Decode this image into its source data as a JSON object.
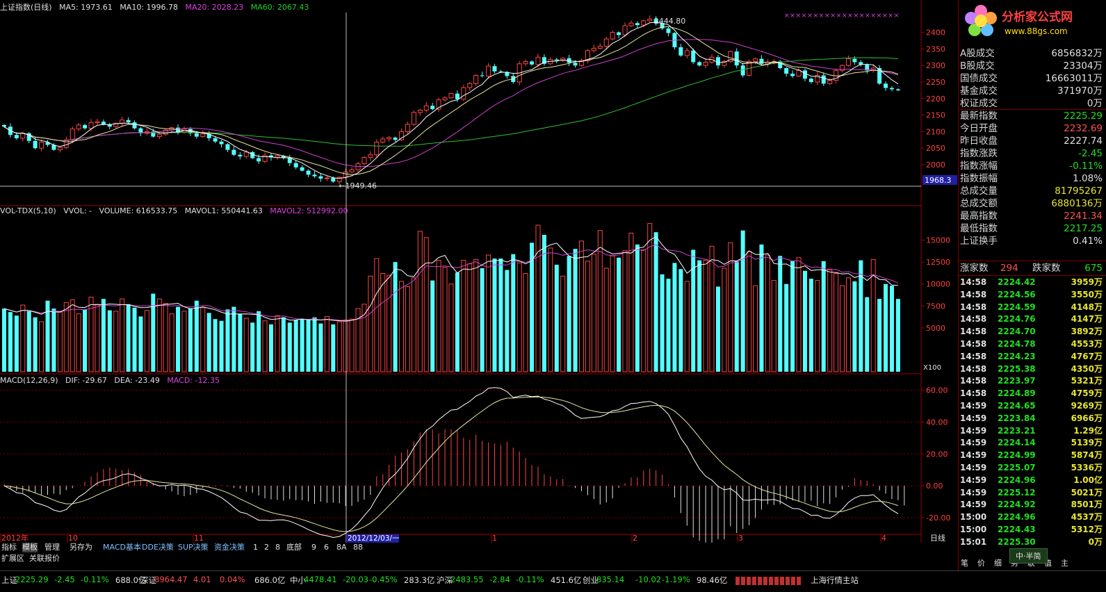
{
  "header": {
    "kline": {
      "name": "上证指数(日线)",
      "ma5": "MA5: 1973.61",
      "ma10": "MA10: 1996.78",
      "ma20": "MA20: 2028.23",
      "ma60": "MA60: 2067.43"
    },
    "vol": {
      "name": "VOL-TDX(5,10)",
      "vvol": "VVOL: -",
      "volume": "VOLUME: 616533.75",
      "mavol1": "MAVOL1: 550441.63",
      "mavol2": "MAVOL2: 512992.00"
    },
    "macd": {
      "name": "MACD(12,26,9)",
      "dif": "DIF: -29.67",
      "dea": "DEA: -23.49",
      "macd": "MACD: -12.35"
    }
  },
  "annotations": {
    "high": "2444.80",
    "low": "←1949.46",
    "low_value": 1949.46,
    "hline_label": "1968.3",
    "x100": "X100",
    "cursor_date": "2012/12/03/一"
  },
  "x_axis_labels": [
    "2012年",
    "10",
    "11",
    "1",
    "2",
    "3",
    "4"
  ],
  "period_label": "日线",
  "chart_data": [
    {
      "type": "candlestick",
      "title": "上证指数(日线)",
      "ylim": [
        1935,
        2460
      ],
      "y_ticks": [
        2000,
        2050,
        2100,
        2150,
        2200,
        2250,
        2300,
        2350,
        2400
      ],
      "high_marker": 2444.8,
      "low_marker": 1949.46,
      "close": [
        2115,
        2090,
        2080,
        2095,
        2072,
        2050,
        2068,
        2060,
        2045,
        2052,
        2075,
        2108,
        2120,
        2110,
        2127,
        2130,
        2122,
        2115,
        2125,
        2135,
        2128,
        2110,
        2095,
        2100,
        2085,
        2092,
        2105,
        2112,
        2098,
        2108,
        2095,
        2085,
        2093,
        2080,
        2070,
        2062,
        2045,
        2030,
        2025,
        2038,
        2020,
        2010,
        2028,
        2022,
        2027,
        2020,
        2005,
        1992,
        1982,
        1970,
        1965,
        1958,
        1960,
        1949,
        1962,
        1978,
        1985,
        2003,
        2022,
        2030,
        2068,
        2078,
        2082,
        2075,
        2100,
        2122,
        2158,
        2165,
        2178,
        2168,
        2196,
        2202,
        2215,
        2198,
        2233,
        2245,
        2270,
        2268,
        2298,
        2282,
        2280,
        2268,
        2250,
        2305,
        2312,
        2303,
        2325,
        2305,
        2318,
        2315,
        2322,
        2308,
        2300,
        2315,
        2345,
        2352,
        2358,
        2380,
        2400,
        2392,
        2420,
        2428,
        2422,
        2435,
        2440,
        2428,
        2412,
        2398,
        2355,
        2330,
        2345,
        2310,
        2300,
        2310,
        2325,
        2300,
        2312,
        2342,
        2300,
        2270,
        2312,
        2320,
        2305,
        2310,
        2312,
        2292,
        2275,
        2268,
        2285,
        2260,
        2250,
        2270,
        2245,
        2255,
        2285,
        2300,
        2320,
        2310,
        2302,
        2285,
        2292,
        2245,
        2232,
        2228,
        2225
      ]
    },
    {
      "type": "bar",
      "title": "VOL-TDX(5,10)",
      "ylim": [
        0,
        17500
      ],
      "y_ticks": [
        5000,
        7500,
        10000,
        12500,
        15000
      ],
      "series": [
        {
          "name": "VOLUME",
          "values": [
            7200,
            6800,
            6400,
            7600,
            6900,
            6200,
            5700,
            8100,
            7200,
            6800,
            7900,
            8200,
            6600,
            7100,
            8500,
            7700,
            8300,
            7000,
            6900,
            8300,
            7700,
            7300,
            6300,
            7000,
            8900,
            8300,
            7800,
            6600,
            7400,
            6900,
            7200,
            8100,
            7300,
            6700,
            6000,
            5800,
            7100,
            7400,
            6600,
            6100,
            5600,
            6900,
            5800,
            5400,
            6400,
            6200,
            5600,
            5900,
            6000,
            5900,
            6200,
            5500,
            6300,
            5400,
            5700,
            5900,
            6000,
            7200,
            7700,
            10900,
            12900,
            11200,
            11000,
            12500,
            10300,
            9700,
            10700,
            16000,
            15300,
            10400,
            12700,
            11900,
            10000,
            11300,
            12700,
            12300,
            12800,
            11800,
            13300,
            12900,
            12900,
            11600,
            13400,
            12400,
            11200,
            14700,
            16700,
            15600,
            14100,
            12200,
            10900,
            13200,
            14000,
            14900,
            12600,
            13400,
            16100,
            11800,
            13200,
            13000,
            13800,
            15800,
            14500,
            13900,
            16900,
            15900,
            11100,
            10600,
            12400,
            11700,
            10300,
            13900,
            12700,
            12700,
            14300,
            9700,
            11800,
            14700,
            12600,
            16100,
            13700,
            9800,
            14500,
            13300,
            10400,
            13200,
            10000,
            12600,
            13000,
            11500,
            10600,
            10400,
            12600,
            11700,
            11200,
            9800,
            10700,
            10300,
            12700,
            8500,
            12800,
            8300,
            10000,
            9800,
            8300
          ]
        }
      ]
    },
    {
      "type": "bar",
      "title": "MACD(12,26,9)",
      "ylim": [
        -30,
        65
      ],
      "y_ticks": [
        -20,
        0,
        20,
        40,
        60
      ],
      "series": [
        {
          "name": "MACD",
          "values": [
            1.2,
            -1.7,
            -3.1,
            -4.2,
            -3.6,
            -4.5,
            -5.7,
            -5.7,
            -5.0,
            -5.5,
            -2.7,
            -1.4,
            0.0,
            2.4,
            5.9,
            8.4,
            10.5,
            11.4,
            10.7,
            9.9,
            10.5,
            8.5,
            6.7,
            4.1,
            1.8,
            -0.4,
            -2.3,
            -3.5,
            -5.6,
            -6.5,
            -5.8,
            -4.6,
            -1.4,
            -0.3,
            -0.3,
            0.3,
            -0.3,
            -1.3,
            -1.8,
            -3.8,
            -4.4,
            -6.0,
            -7.9,
            -8.5,
            -8.8,
            -9.3,
            -8.4,
            -9.0,
            -9.1,
            -9.8,
            -11.3,
            -9.9,
            -10.6,
            -10.6,
            -11.0,
            -12.7,
            -12.6,
            -10.1,
            -8.7,
            -5.7,
            6.0,
            7.3,
            13.1,
            19.0,
            20.8,
            23.0,
            27.9,
            33.4,
            35.6,
            35.3,
            32.9,
            35.6,
            35.5,
            34.9,
            30.1,
            29.1,
            32.1,
            28.2,
            27.2,
            26.5,
            25.7,
            27.7,
            24.0,
            21.5,
            17.5,
            13.0,
            12.1,
            7.3,
            5.8,
            4.1,
            4.4,
            -0.2,
            -1.4,
            -3.3,
            -5.9,
            -8.3,
            -11.7,
            -10.5,
            -7.9,
            -1.2,
            1.6,
            5.2,
            5.3,
            9.4,
            10.6,
            9.8,
            7.1,
            1.0,
            -7.3,
            -17.1,
            -25.0,
            -32.3,
            -34.5,
            -35.6,
            -35.8,
            -33.6,
            -33.6,
            -25.4,
            -29.6,
            -27.1,
            -24.7,
            -20.2,
            -14.9,
            -11.6,
            -12.0,
            -11.6,
            -8.6,
            -9.2,
            -10.1,
            -10.2,
            -9.3,
            -12.7,
            -11.0,
            -11.4,
            -7.2,
            -2.4,
            -0.5,
            4.8,
            3.6,
            3.1,
            1.1,
            -2.9,
            -4.9,
            -8.3,
            -9.0,
            -12.3
          ]
        }
      ]
    }
  ],
  "right_panel": {
    "logo_title": "分析家公式网",
    "logo_url": "www.88gs.com",
    "quotes": [
      {
        "label": "A股成交",
        "value": "6856832万",
        "color": "#e0e0e0"
      },
      {
        "label": "B股成交",
        "value": "23304万",
        "color": "#e0e0e0"
      },
      {
        "label": "国债成交",
        "value": "16663011万",
        "color": "#e0e0e0"
      },
      {
        "label": "基金成交",
        "value": "371970万",
        "color": "#e0e0e0"
      },
      {
        "label": "权证成交",
        "value": "0万",
        "color": "#e0e0e0"
      },
      {
        "label": "最新指数",
        "value": "2225.29",
        "color": "#20e020"
      },
      {
        "label": "今日开盘",
        "value": "2232.69",
        "color": "#ff5050"
      },
      {
        "label": "昨日收盘",
        "value": "2227.74",
        "color": "#e0e0e0"
      },
      {
        "label": "指数涨跌",
        "value": "-2.45",
        "color": "#20e020"
      },
      {
        "label": "指数涨幅",
        "value": "-0.11%",
        "color": "#20e020"
      },
      {
        "label": "指数振幅",
        "value": "1.08%",
        "color": "#e0e0e0"
      },
      {
        "label": "总成交量",
        "value": "81795267",
        "color": "#e8e830"
      },
      {
        "label": "总成交额",
        "value": "6880136万",
        "color": "#e8e830"
      },
      {
        "label": "最高指数",
        "value": "2241.34",
        "color": "#ff5050"
      },
      {
        "label": "最低指数",
        "value": "2217.25",
        "color": "#20e020"
      },
      {
        "label": "上证换手",
        "value": "0.41%",
        "color": "#e0e0e0"
      }
    ],
    "advdec": {
      "up_label": "涨家数",
      "up": "294",
      "down_label": "跌家数",
      "down": "675"
    },
    "ticks": [
      {
        "t": "14:58",
        "p": "2224.42",
        "v": "3959万"
      },
      {
        "t": "14:58",
        "p": "2224.56",
        "v": "3550万"
      },
      {
        "t": "14:58",
        "p": "2224.59",
        "v": "4148万"
      },
      {
        "t": "14:58",
        "p": "2224.76",
        "v": "4147万"
      },
      {
        "t": "14:58",
        "p": "2224.70",
        "v": "3892万"
      },
      {
        "t": "14:58",
        "p": "2224.78",
        "v": "4553万"
      },
      {
        "t": "14:58",
        "p": "2224.23",
        "v": "4767万"
      },
      {
        "t": "14:58",
        "p": "2225.38",
        "v": "4350万"
      },
      {
        "t": "14:58",
        "p": "2223.97",
        "v": "5321万"
      },
      {
        "t": "14:58",
        "p": "2224.89",
        "v": "4759万"
      },
      {
        "t": "14:59",
        "p": "2224.65",
        "v": "9269万"
      },
      {
        "t": "14:59",
        "p": "2223.84",
        "v": "6966万"
      },
      {
        "t": "14:59",
        "p": "2223.21",
        "v": "1.29亿"
      },
      {
        "t": "14:59",
        "p": "2224.14",
        "v": "5139万"
      },
      {
        "t": "14:59",
        "p": "2224.99",
        "v": "5874万"
      },
      {
        "t": "14:59",
        "p": "2225.07",
        "v": "5336万"
      },
      {
        "t": "14:59",
        "p": "2224.96",
        "v": "1.00亿"
      },
      {
        "t": "14:59",
        "p": "2225.12",
        "v": "5021万"
      },
      {
        "t": "14:59",
        "p": "2224.92",
        "v": "8501万"
      },
      {
        "t": "15:00",
        "p": "2224.96",
        "v": "4537万"
      },
      {
        "t": "15:00",
        "p": "2224.43",
        "v": "5312万"
      },
      {
        "t": "15:01",
        "p": "2225.30",
        "v": "0万"
      }
    ],
    "buttons": [
      "笔",
      "价",
      "细",
      "势",
      "联",
      "值",
      "主"
    ],
    "badge": "中·半简"
  },
  "tabs": [
    "指标",
    "模板",
    "管理",
    "另存为",
    "MACD基本",
    "DDE决策",
    "SUP决策",
    "资金决策",
    "1",
    "2",
    "8",
    "底部",
    "9",
    "6",
    "8A",
    "88"
  ],
  "tabs2": [
    "扩展区",
    "关联报价"
  ],
  "status": [
    {
      "name": "上证",
      "price": "2225.29",
      "chg": "-2.45",
      "pct": "-0.11%",
      "amt": "688.0亿"
    },
    {
      "name": "深证",
      "price": "8964.47",
      "chg": "4.01",
      "pct": "0.04%",
      "amt": "686.0亿"
    },
    {
      "name": "中小",
      "price": "4478.41",
      "chg": "-20.03",
      "pct": "-0.45%",
      "amt": "283.3亿"
    },
    {
      "name": "沪深",
      "price": "2483.55",
      "chg": "-2.84",
      "pct": "-0.11%",
      "amt": "451.6亿"
    },
    {
      "name": "创业",
      "price": "835.14",
      "chg": "-10.02",
      "pct": "-1.19%",
      "amt": "98.46亿"
    }
  ],
  "station": "上海行情主站",
  "colors": {
    "up": "#ff4444",
    "down": "#54ffff",
    "ma5": "#ffffff",
    "ma10": "#e8e8a0",
    "ma20": "#d040d0",
    "ma60": "#30c030",
    "grid": "#800000"
  }
}
